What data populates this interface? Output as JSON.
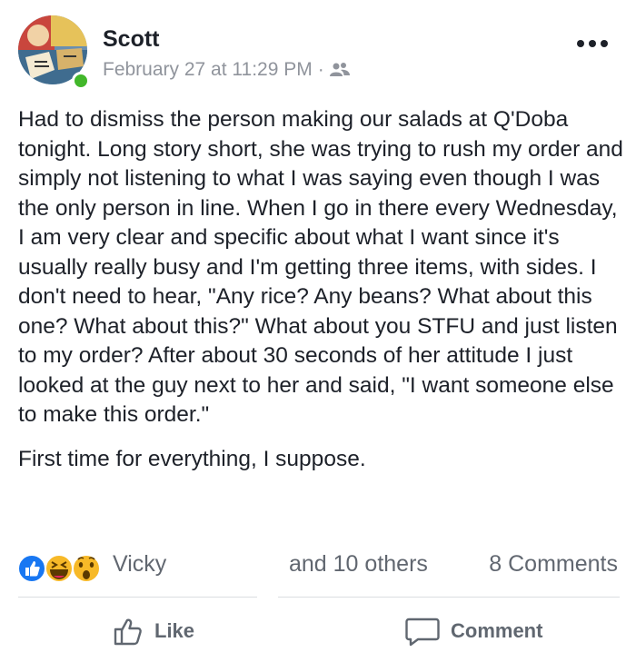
{
  "post": {
    "author": "Scott",
    "timestamp": "February 27 at 11:29 PM",
    "meta_separator": "·",
    "audience_icon": "friends-icon",
    "more_icon": "more-options-icon",
    "online": true,
    "body": [
      "Had to dismiss the person making our salads at Q'Doba tonight. Long story short, she was trying to rush my order and simply not listening to what I was saying even though I was the only person in line. When I go in there every Wednesday, I am very clear and specific about what I want since it's usually really busy and I'm getting three items, with sides. I don't need to hear, \"Any rice? Any beans? What about this one? What about this?\" What about you STFU and just listen to my order? After about 30 seconds of her attitude I just looked at the guy next to her and said, \"I want someone else to make this order.\"",
      "First time for everything, I suppose."
    ]
  },
  "reactions": {
    "icons": [
      "like-reaction-icon",
      "haha-reaction-icon",
      "wow-reaction-icon"
    ],
    "first_name": "Vicky",
    "others": "and 10 others",
    "comments": "8 Comments"
  },
  "actions": {
    "like_label": "Like",
    "comment_label": "Comment"
  },
  "colors": {
    "like_blue": "#1877f2",
    "reaction_yellow": "#f7b928",
    "online_green": "#42b72a",
    "meta_gray": "#90949c"
  }
}
